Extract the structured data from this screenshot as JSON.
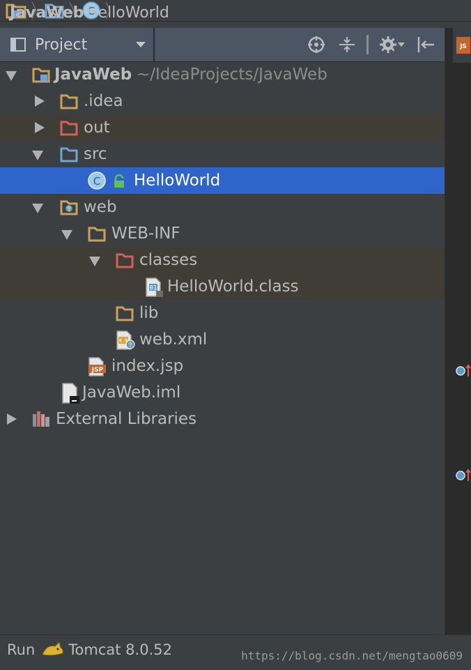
{
  "breadcrumb": {
    "items": [
      {
        "label": "JavaWeb",
        "icon": "module-folder-icon"
      },
      {
        "label": "src",
        "icon": "source-folder-icon"
      },
      {
        "label": "HelloWorld",
        "icon": "java-class-icon"
      }
    ]
  },
  "project_panel": {
    "view_selector": "Project",
    "tools": [
      "locate-icon",
      "collapse-all-icon",
      "gear-icon",
      "hide-icon"
    ]
  },
  "tree": [
    {
      "label": "JavaWeb",
      "suffix": "~/IdeaProjects/JavaWeb",
      "icon": "module-folder-icon",
      "expanded": true
    },
    {
      "label": ".idea",
      "icon": "folder-icon",
      "expanded": false
    },
    {
      "label": "out",
      "icon": "excluded-folder-icon",
      "expanded": false
    },
    {
      "label": "src",
      "icon": "source-folder-icon",
      "expanded": true
    },
    {
      "label": "HelloWorld",
      "icon": "java-class-icon",
      "selected": true
    },
    {
      "label": "web",
      "icon": "web-folder-icon",
      "expanded": true
    },
    {
      "label": "WEB-INF",
      "icon": "folder-icon",
      "expanded": true
    },
    {
      "label": "classes",
      "icon": "excluded-folder-icon",
      "expanded": true
    },
    {
      "label": "HelloWorld.class",
      "icon": "class-file-icon"
    },
    {
      "label": "lib",
      "icon": "folder-icon"
    },
    {
      "label": "web.xml",
      "icon": "web-xml-icon"
    },
    {
      "label": "index.jsp",
      "icon": "jsp-file-icon"
    },
    {
      "label": "JavaWeb.iml",
      "icon": "iml-file-icon"
    },
    {
      "label": "External Libraries",
      "icon": "libraries-icon",
      "expanded": false
    }
  ],
  "statusbar": {
    "run_label": "Run",
    "config_label": "Tomcat 8.0.52",
    "watermark": "https://blog.csdn.net/mengtao0609"
  },
  "colors": {
    "selection": "#2f65ca",
    "excluded_row": "#3f3d36",
    "folder": "#c9a15a",
    "excluded_folder": "#d0625a",
    "source_folder": "#6fa4d0"
  }
}
